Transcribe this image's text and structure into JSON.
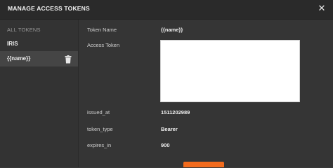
{
  "header": {
    "title": "MANAGE ACCESS TOKENS",
    "close_glyph": "✕"
  },
  "sidebar": {
    "heading": "ALL TOKENS",
    "items": [
      {
        "label": "IRIS",
        "active": false
      },
      {
        "label": "{{name}}",
        "active": true
      }
    ]
  },
  "details": {
    "token_name_label": "Token Name",
    "token_name_value": "{{name}}",
    "access_token_label": "Access Token",
    "access_token_value": "",
    "issued_at_label": "issued_at",
    "issued_at_value": "1511202989",
    "token_type_label": "token_type",
    "token_type_value": "Bearer",
    "expires_in_label": "expires_in",
    "expires_in_value": "900"
  },
  "colors": {
    "accent": "#f26b1d",
    "background": "#353535",
    "header": "#2a2a2a"
  },
  "icons": {
    "close": "close-icon",
    "delete": "trash-icon"
  }
}
